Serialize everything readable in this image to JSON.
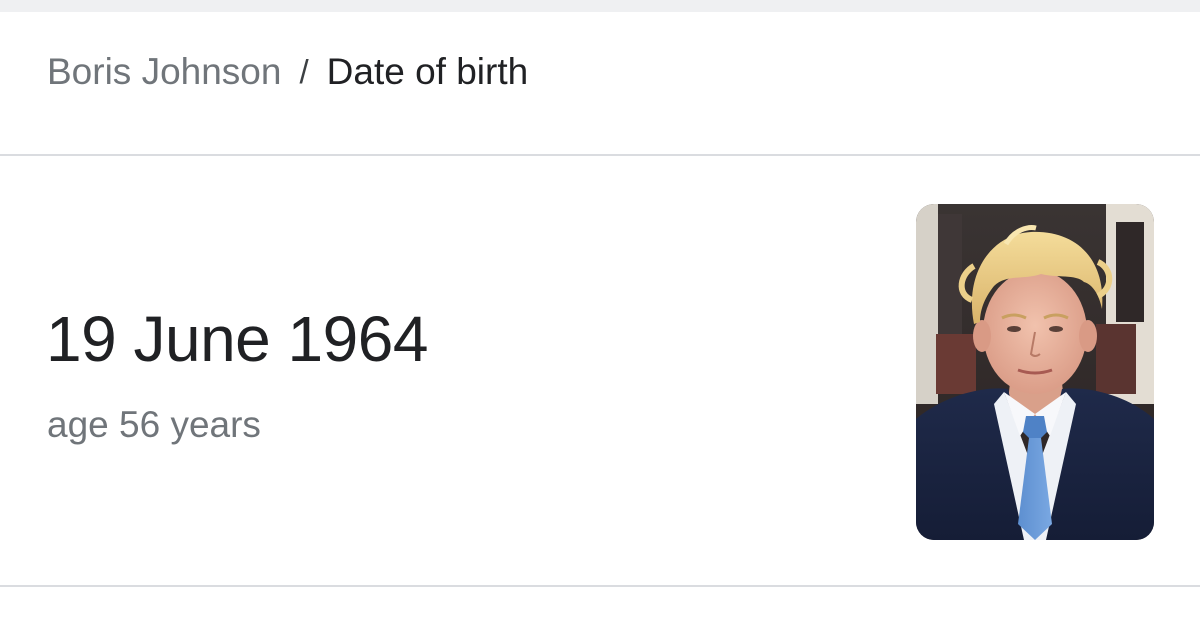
{
  "breadcrumb": {
    "entity": "Boris Johnson",
    "separator": "/",
    "attribute": "Date of birth"
  },
  "answer": {
    "date": "19 June 1964",
    "age": "age 56 years"
  },
  "thumbnail": {
    "subject": "portrait-photo"
  }
}
